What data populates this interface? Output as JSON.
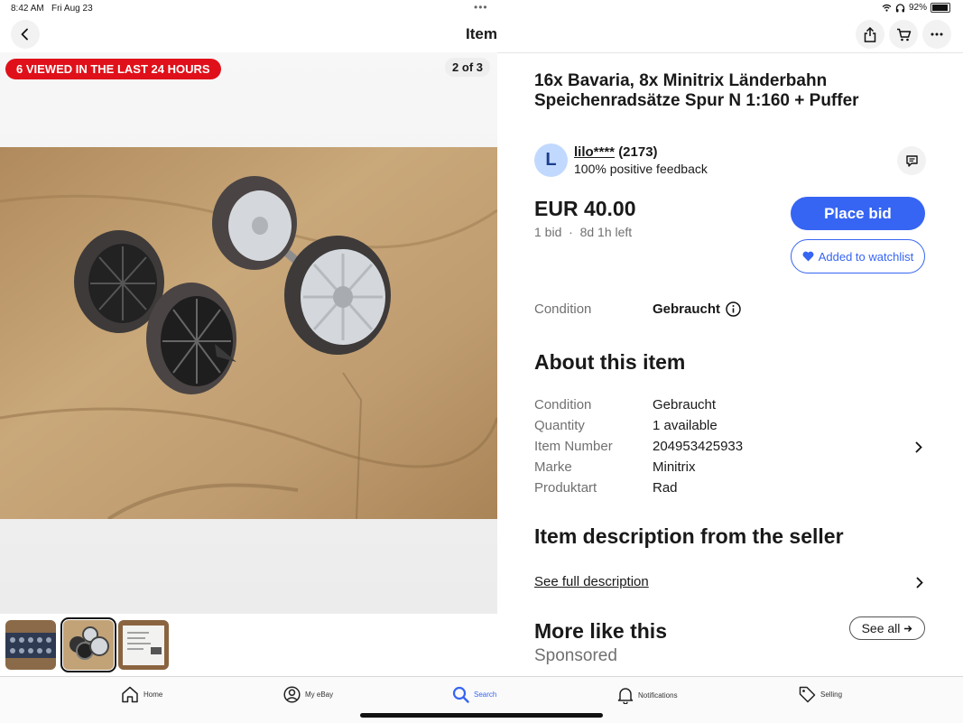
{
  "status_bar": {
    "time": "8:42 AM",
    "date": "Fri Aug 23",
    "battery": "92%",
    "battery_level": 0.92,
    "icons": [
      "wifi-icon",
      "headphones-icon",
      "battery-icon"
    ]
  },
  "nav": {
    "title": "Item",
    "icons": [
      "back-chevron-icon",
      "share-icon",
      "cart-icon",
      "more-icon"
    ]
  },
  "gallery": {
    "viewed_badge": "6 VIEWED IN THE LAST 24 HOURS",
    "counter": "2 of 3",
    "thumbnail_count": 3,
    "selected_thumbnail": 2
  },
  "item": {
    "title": "16x Bavaria, 8x Minitrix Länderbahn Speichenradsätze Spur N 1:160 + Puffer",
    "seller": {
      "initial": "L",
      "name": "lilo****",
      "count": "(2173)",
      "feedback": "100% positive feedback"
    },
    "price": "EUR 40.00",
    "bids": "1 bid",
    "separator": "·",
    "time_left": "8d 1h left",
    "place_bid_label": "Place bid",
    "watchlist_label": "Added to watchlist",
    "condition_label": "Condition",
    "condition_value": "Gebraucht"
  },
  "about": {
    "heading": "About this item",
    "rows": [
      {
        "key": "Condition",
        "value": "Gebraucht"
      },
      {
        "key": "Quantity",
        "value": "1 available"
      },
      {
        "key": "Item Number",
        "value": "204953425933"
      },
      {
        "key": "Marke",
        "value": "Minitrix"
      },
      {
        "key": "Produktart",
        "value": "Rad"
      }
    ]
  },
  "description": {
    "heading": "Item description from the seller",
    "link": "See full description"
  },
  "more": {
    "heading": "More like this",
    "see_all": "See all",
    "sponsored": "Sponsored"
  },
  "tabs": [
    {
      "label": "Home",
      "icon": "home-icon"
    },
    {
      "label": "My eBay",
      "icon": "user-icon"
    },
    {
      "label": "Search",
      "icon": "search-icon",
      "active": true
    },
    {
      "label": "Notifications",
      "icon": "bell-icon"
    },
    {
      "label": "Selling",
      "icon": "tag-icon"
    }
  ],
  "colors": {
    "accent": "#3665f3",
    "badge": "#e0101a",
    "text": "#191919",
    "muted": "#707070"
  }
}
